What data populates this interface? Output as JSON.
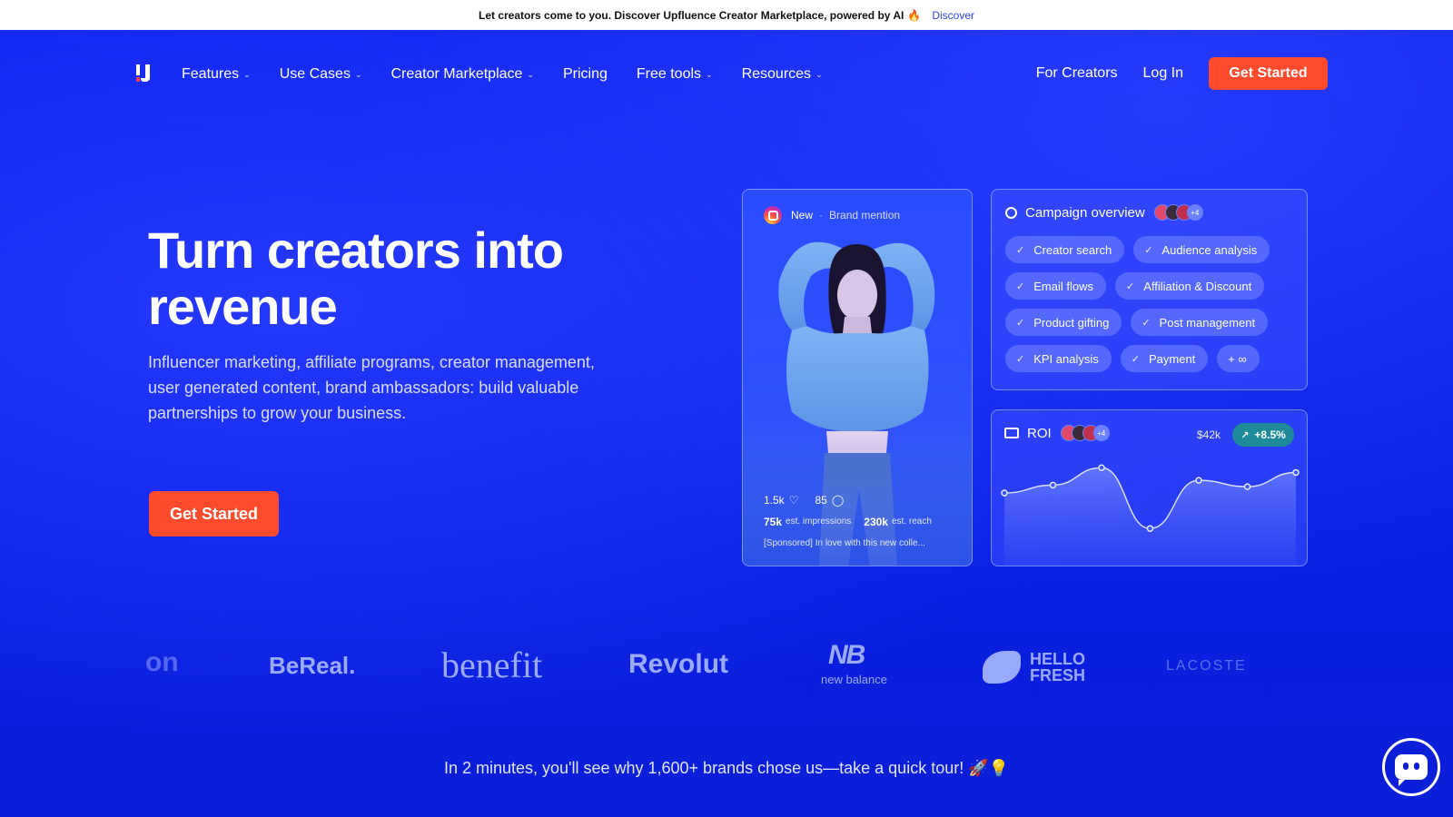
{
  "announcement": {
    "text": "Let creators come to you. Discover Upfluence Creator Marketplace, powered by AI",
    "emoji": "🔥",
    "link": "Discover"
  },
  "nav": {
    "items": [
      {
        "label": "Features",
        "dropdown": true
      },
      {
        "label": "Use Cases",
        "dropdown": true
      },
      {
        "label": "Creator Marketplace",
        "dropdown": true
      },
      {
        "label": "Pricing",
        "dropdown": false
      },
      {
        "label": "Free tools",
        "dropdown": true
      },
      {
        "label": "Resources",
        "dropdown": true
      }
    ],
    "for_creators": "For Creators",
    "login": "Log In",
    "cta": "Get Started"
  },
  "hero": {
    "headline": "Turn creators into revenue",
    "subtitle": "Influencer marketing, affiliate programs, creator management, user generated content, brand ambassadors: build valuable partnerships to grow your business.",
    "cta": "Get Started"
  },
  "post_card": {
    "badge": "New",
    "type": "Brand mention",
    "likes": "1.5k",
    "comments": "85",
    "impressions": "75k",
    "impressions_label": "est. impressions",
    "reach": "230k",
    "reach_label": "est. reach",
    "caption": "[Sponsored] In love with this new colle..."
  },
  "campaign": {
    "title": "Campaign overview",
    "avatar_count": "+4",
    "chips": [
      "Creator search",
      "Audience analysis",
      "Email flows",
      "Affiliation & Discount",
      "Product gifting",
      "Post management",
      "KPI analysis",
      "Payment"
    ],
    "more": "+ ∞"
  },
  "roi": {
    "title": "ROI",
    "avatar_count": "+4",
    "value": "$42k",
    "change": "+8.5%",
    "series": [
      0.62,
      0.72,
      0.94,
      0.17,
      0.78,
      0.7,
      0.88
    ]
  },
  "logos": [
    "on",
    "BeReal.",
    "benefit",
    "Revolut",
    "new balance",
    "HELLO FRESH",
    "LACOSTE"
  ],
  "tour": "In 2 minutes, you'll see why 1,600+ brands chose us—take a quick tour! 🚀💡",
  "colors": {
    "background": "#0a1fe8",
    "accent": "#ff4a2b",
    "badge": "#1e8b9a"
  }
}
